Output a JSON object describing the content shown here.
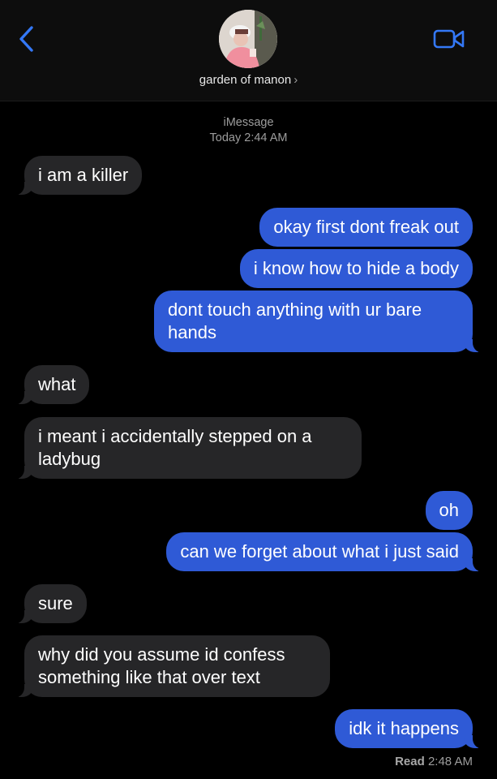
{
  "header": {
    "contact_name": "garden of manon",
    "chevron": "›",
    "back_icon": "chevron-left-icon",
    "video_icon": "video-camera-icon",
    "accent_color": "#2f6fe4"
  },
  "conversation": {
    "service": "iMessage",
    "timestamp": "Today 2:44 AM"
  },
  "messages": [
    {
      "from": "them",
      "text": "i am a killer"
    },
    {
      "from": "me",
      "text": "okay first dont freak out"
    },
    {
      "from": "me",
      "text": "i know how to hide a body"
    },
    {
      "from": "me",
      "text": "dont touch anything with ur bare hands"
    },
    {
      "from": "them",
      "text": "what"
    },
    {
      "from": "them",
      "text": "i meant i accidentally stepped on a ladybug"
    },
    {
      "from": "me",
      "text": "oh"
    },
    {
      "from": "me",
      "text": "can we forget about what i just said"
    },
    {
      "from": "them",
      "text": "sure"
    },
    {
      "from": "them",
      "text": "why did you assume id confess something like that over text"
    },
    {
      "from": "me",
      "text": "idk it happens"
    }
  ],
  "receipt": {
    "label": "Read",
    "time": "2:48 AM"
  },
  "colors": {
    "incoming_bubble": "#262628",
    "outgoing_bubble": "#2f5ad6",
    "background": "#000000"
  }
}
